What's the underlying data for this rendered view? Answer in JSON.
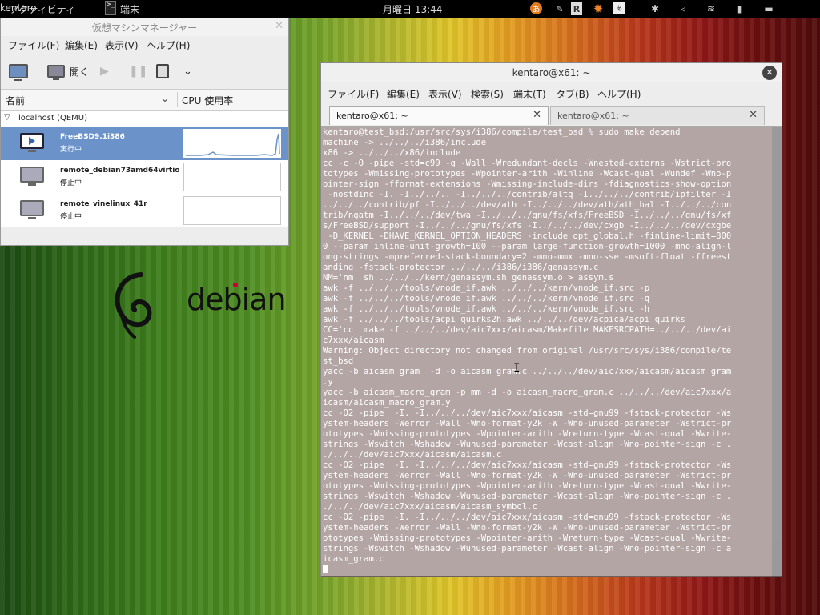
{
  "top_panel": {
    "activities": "アクティビティ",
    "app_name": "端末",
    "clock": "月曜日 13:44",
    "user": "kentaro",
    "tray_icons": [
      "ime-icon",
      "r-icon",
      "settings-icon",
      "keyboard-icon",
      "accessibility-icon",
      "volume-icon",
      "wifi-icon",
      "battery-icon",
      "user-icon"
    ]
  },
  "vmm": {
    "title": "仮想マシンマネージャー",
    "menu": [
      "ファイル(F)",
      "編集(E)",
      "表示(V)",
      "ヘルプ(H)"
    ],
    "toolbar": {
      "open_label": "開く"
    },
    "columns": {
      "name": "名前",
      "cpu": "CPU 使用率"
    },
    "host": "localhost (QEMU)",
    "vms": [
      {
        "name": "FreeBSD9.1i386",
        "state": "実行中",
        "selected": true
      },
      {
        "name": "remote_debian73amd64virtio",
        "state": "停止中",
        "selected": false
      },
      {
        "name": "remote_vinelinux_41r",
        "state": "停止中",
        "selected": false
      }
    ]
  },
  "desktop": {
    "logo_text": "debian"
  },
  "terminal": {
    "title": "kentaro@x61: ~",
    "menu": [
      "ファイル(F)",
      "編集(E)",
      "表示(V)",
      "検索(S)",
      "端末(T)",
      "タブ(B)",
      "ヘルプ(H)"
    ],
    "tabs": [
      "kentaro@x61: ~",
      "kentaro@x61: ~"
    ],
    "lines": [
      "kentaro@test_bsd:/usr/src/sys/i386/compile/test_bsd % sudo make depend",
      "machine -> ../../../i386/include",
      "x86 -> ../../../x86/include",
      "cc -c -O -pipe -std=c99 -g -Wall -Wredundant-decls -Wnested-externs -Wstrict-pro",
      "totypes -Wmissing-prototypes -Wpointer-arith -Winline -Wcast-qual -Wundef -Wno-p",
      "ointer-sign -fformat-extensions -Wmissing-include-dirs -fdiagnostics-show-option",
      " -nostdinc -I. -I../../.. -I../../../contrib/altq -I../../../contrib/ipfilter -I",
      "../../../contrib/pf -I../../../dev/ath -I../../../dev/ath/ath_hal -I../../../con",
      "trib/ngatm -I../../../dev/twa -I../../../gnu/fs/xfs/FreeBSD -I../../../gnu/fs/xf",
      "s/FreeBSD/support -I../../../gnu/fs/xfs -I../../../dev/cxgb -I../../../dev/cxgbe",
      " -D_KERNEL -DHAVE_KERNEL_OPTION_HEADERS -include opt_global.h -finline-limit=800",
      "0 --param inline-unit-growth=100 --param large-function-growth=1000 -mno-align-l",
      "ong-strings -mpreferred-stack-boundary=2 -mno-mmx -mno-sse -msoft-float -ffreest",
      "anding -fstack-protector ../../../i386/i386/genassym.c",
      "NM='nm' sh ../../../kern/genassym.sh genassym.o > assym.s",
      "awk -f ../../../tools/vnode_if.awk ../../../kern/vnode_if.src -p",
      "awk -f ../../../tools/vnode_if.awk ../../../kern/vnode_if.src -q",
      "awk -f ../../../tools/vnode_if.awk ../../../kern/vnode_if.src -h",
      "awk -f ../../../tools/acpi_quirks2h.awk ../../../dev/acpica/acpi_quirks",
      "CC='cc' make -f ../../../dev/aic7xxx/aicasm/Makefile MAKESRCPATH=../../../dev/ai",
      "c7xxx/aicasm",
      "Warning: Object directory not changed from original /usr/src/sys/i386/compile/te",
      "st_bsd",
      "yacc -b aicasm_gram  -d -o aicasm_gram.c ../../../dev/aic7xxx/aicasm/aicasm_gram",
      ".y",
      "yacc -b aicasm_macro_gram -p mm -d -o aicasm_macro_gram.c ../../../dev/aic7xxx/a",
      "icasm/aicasm_macro_gram.y",
      "cc -O2 -pipe  -I. -I../../../dev/aic7xxx/aicasm -std=gnu99 -fstack-protector -Ws",
      "ystem-headers -Werror -Wall -Wno-format-y2k -W -Wno-unused-parameter -Wstrict-pr",
      "ototypes -Wmissing-prototypes -Wpointer-arith -Wreturn-type -Wcast-qual -Wwrite-",
      "strings -Wswitch -Wshadow -Wunused-parameter -Wcast-align -Wno-pointer-sign -c .",
      "./../../dev/aic7xxx/aicasm/aicasm.c",
      "cc -O2 -pipe  -I. -I../../../dev/aic7xxx/aicasm -std=gnu99 -fstack-protector -Ws",
      "ystem-headers -Werror -Wall -Wno-format-y2k -W -Wno-unused-parameter -Wstrict-pr",
      "ototypes -Wmissing-prototypes -Wpointer-arith -Wreturn-type -Wcast-qual -Wwrite-",
      "strings -Wswitch -Wshadow -Wunused-parameter -Wcast-align -Wno-pointer-sign -c .",
      "./../../dev/aic7xxx/aicasm/aicasm_symbol.c",
      "cc -O2 -pipe  -I. -I../../../dev/aic7xxx/aicasm -std=gnu99 -fstack-protector -Ws",
      "ystem-headers -Werror -Wall -Wno-format-y2k -W -Wno-unused-parameter -Wstrict-pr",
      "ototypes -Wmissing-prototypes -Wpointer-arith -Wreturn-type -Wcast-qual -Wwrite-",
      "strings -Wswitch -Wshadow -Wunused-parameter -Wcast-align -Wno-pointer-sign -c a",
      "icasm_gram.c"
    ]
  }
}
